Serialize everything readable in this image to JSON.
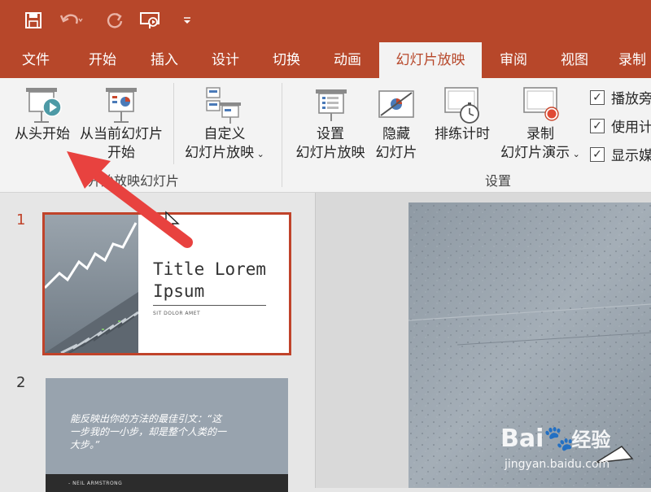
{
  "quick_access": {
    "save_icon": "save-icon",
    "undo_icon": "undo-icon",
    "redo_icon": "redo-icon",
    "present_icon": "present-from-beginning-icon",
    "customize_icon": "customize-dropdown-icon"
  },
  "tabs": [
    {
      "label": "文件"
    },
    {
      "label": "开始"
    },
    {
      "label": "插入"
    },
    {
      "label": "设计"
    },
    {
      "label": "切换"
    },
    {
      "label": "动画"
    },
    {
      "label": "幻灯片放映",
      "active": true
    },
    {
      "label": "审阅"
    },
    {
      "label": "视图"
    },
    {
      "label": "录制"
    }
  ],
  "ribbon": {
    "from_beginning": "从头开始",
    "from_current_line1": "从当前幻灯片",
    "from_current_line2": "开始",
    "custom_line1": "自定义",
    "custom_line2": "幻灯片放映",
    "group_start": "开始放映幻灯片",
    "setup_line1": "设置",
    "setup_line2": "幻灯片放映",
    "hide_line1": "隐藏",
    "hide_line2": "幻灯片",
    "rehearse": "排练计时",
    "record_line1": "录制",
    "record_line2": "幻灯片演示",
    "group_setup": "设置",
    "checkboxes": [
      {
        "label": "播放旁",
        "checked": true
      },
      {
        "label": "使用计",
        "checked": true
      },
      {
        "label": "显示媒",
        "checked": true
      }
    ]
  },
  "slides": {
    "num1": "1",
    "num2": "2",
    "s1_title_line1": "Title Lorem",
    "s1_title_line2": "Ipsum",
    "s1_subtitle": "SIT DOLOR AMET",
    "s2_quote_line1": "能反映出你的方法的最佳引文：“这",
    "s2_quote_line2": "一步我的一小步，却是整个人类的一",
    "s2_quote_line3": "大步。”",
    "s2_author": "- NEIL ARMSTRONG"
  },
  "watermark": {
    "brand": "Bai",
    "brand_suffix": "经验",
    "url": "jingyan.baidu.com"
  },
  "colors": {
    "brand": "#b7472a",
    "ribbon": "#f3f3f3",
    "arrow": "#e8423f"
  }
}
